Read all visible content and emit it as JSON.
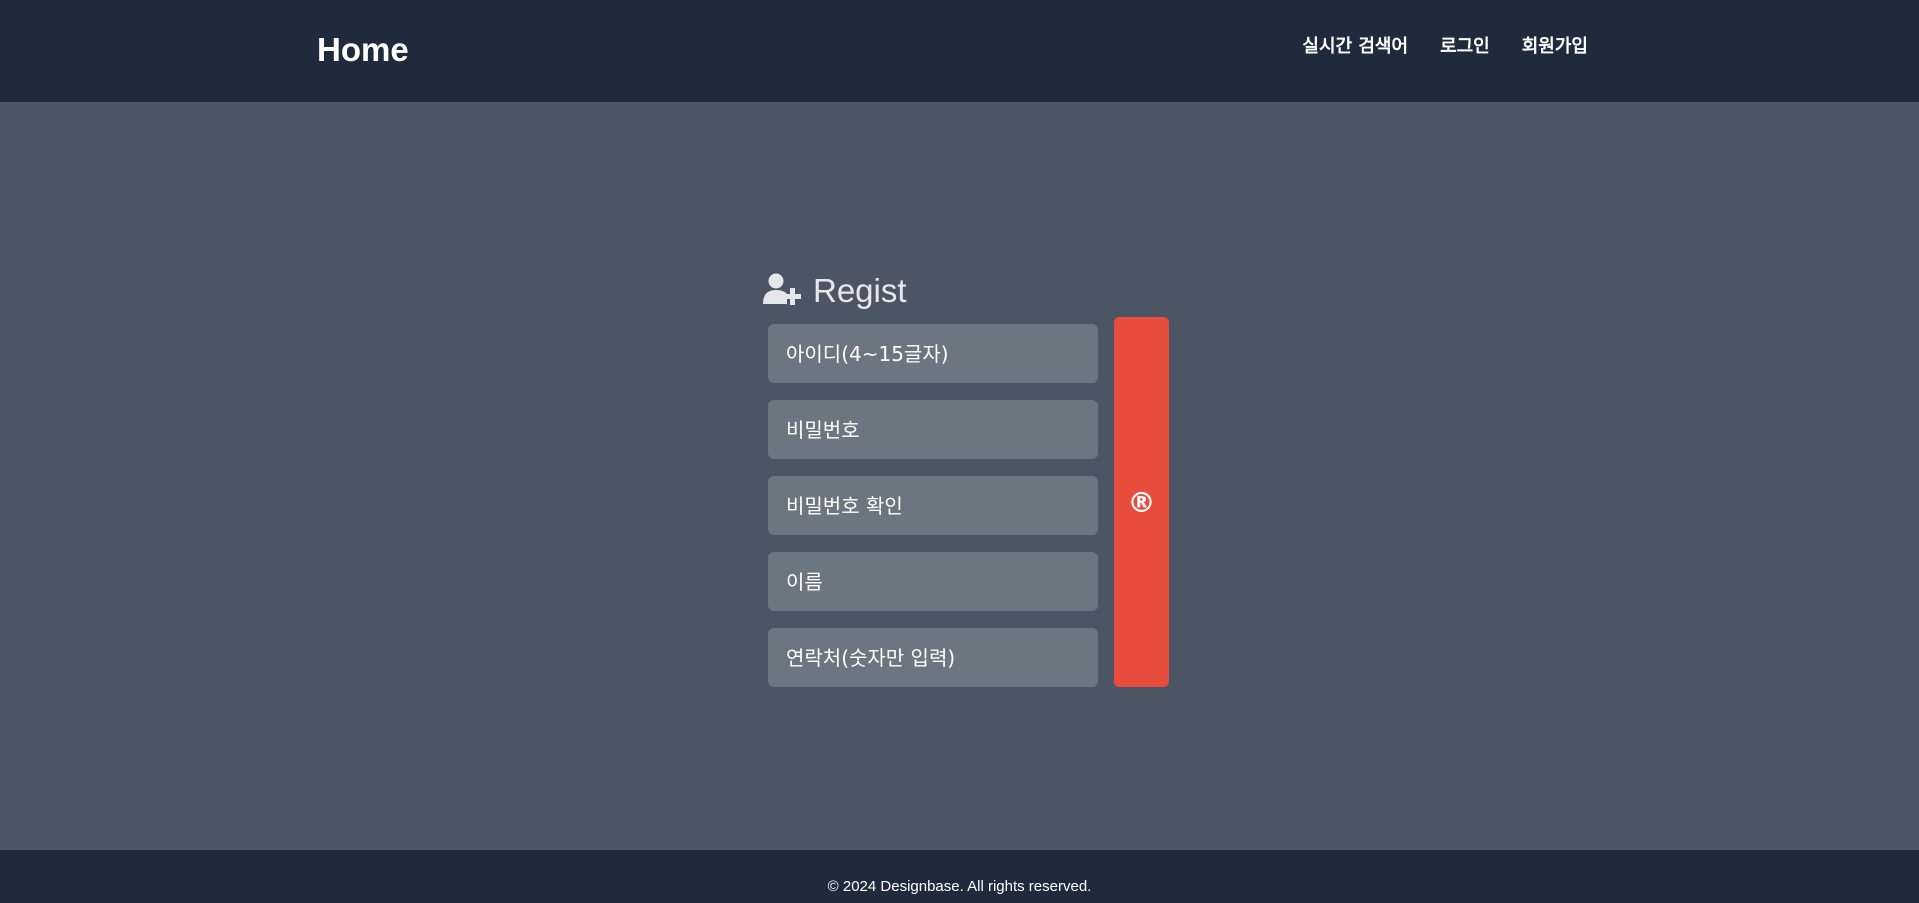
{
  "header": {
    "brand": "Home",
    "nav": [
      {
        "label": "실시간 검색어"
      },
      {
        "label": "로그인"
      },
      {
        "label": "회원가입"
      }
    ]
  },
  "form": {
    "title": "Regist",
    "title_icon": "user-plus-icon",
    "fields": [
      {
        "placeholder": "아이디(4~15글자)",
        "value": ""
      },
      {
        "placeholder": "비밀번호",
        "value": ""
      },
      {
        "placeholder": "비밀번호 확인",
        "value": ""
      },
      {
        "placeholder": "이름",
        "value": ""
      },
      {
        "placeholder": "연락처(숫자만 입력)",
        "value": ""
      }
    ],
    "submit_symbol": "®"
  },
  "footer": {
    "text": "© 2024 Designbase. All rights reserved."
  },
  "colors": {
    "header_bg": "#1f2b3d",
    "page_bg": "#4b5563",
    "input_bg": "#6b7680",
    "submit_bg": "#e74c3c",
    "text": "#ffffff"
  }
}
